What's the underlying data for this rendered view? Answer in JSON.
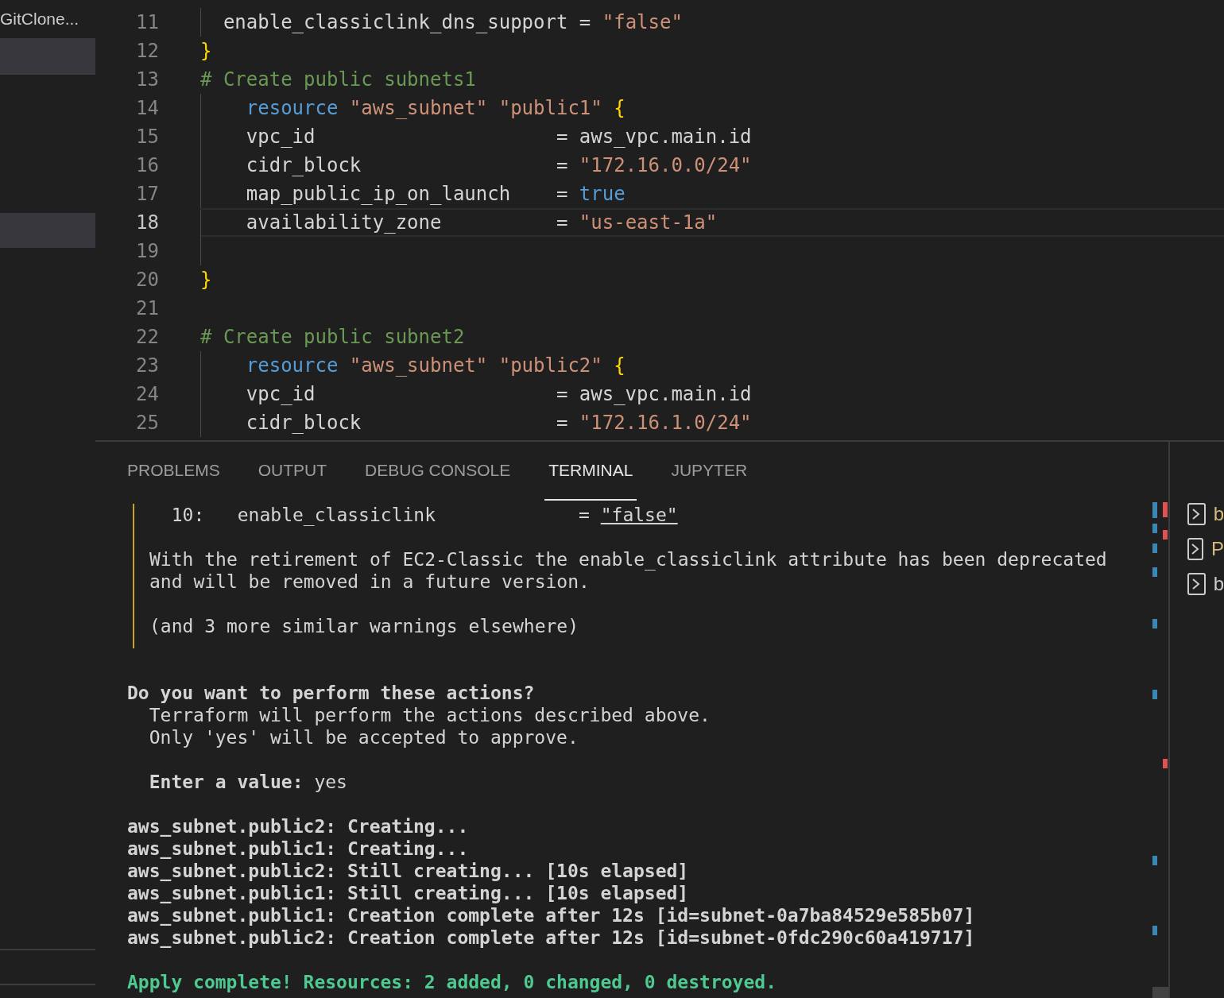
{
  "sidebar": {
    "title": "GitClone...",
    "rows": [
      {
        "selected": true
      },
      {
        "selected": true
      }
    ]
  },
  "editor": {
    "lines": [
      {
        "number": "11",
        "current": false,
        "guide": true,
        "tokens": [
          {
            "kind": "plain",
            "text": "  enable_classiclink_dns_support = "
          },
          {
            "kind": "string",
            "text": "\"false\""
          }
        ]
      },
      {
        "number": "12",
        "current": false,
        "guide": false,
        "tokens": [
          {
            "kind": "brace",
            "text": "}"
          }
        ]
      },
      {
        "number": "13",
        "current": false,
        "guide": false,
        "tokens": [
          {
            "kind": "comment",
            "text": "# Create public subnets1"
          }
        ]
      },
      {
        "number": "14",
        "current": false,
        "guide": true,
        "tokens": [
          {
            "kind": "keyword",
            "text": "    resource"
          },
          {
            "kind": "string",
            "text": " \"aws_subnet\" \"public1\" "
          },
          {
            "kind": "brace",
            "text": "{"
          }
        ]
      },
      {
        "number": "15",
        "current": false,
        "guide": true,
        "tokens": [
          {
            "kind": "plain",
            "text": "    vpc_id                     = aws_vpc.main.id"
          }
        ]
      },
      {
        "number": "16",
        "current": false,
        "guide": true,
        "tokens": [
          {
            "kind": "plain",
            "text": "    cidr_block                 = "
          },
          {
            "kind": "string",
            "text": "\"172.16.0.0/24\""
          }
        ]
      },
      {
        "number": "17",
        "current": false,
        "guide": true,
        "tokens": [
          {
            "kind": "plain",
            "text": "    map_public_ip_on_launch    = "
          },
          {
            "kind": "keyword",
            "text": "true"
          }
        ]
      },
      {
        "number": "18",
        "current": true,
        "guide": true,
        "tokens": [
          {
            "kind": "plain",
            "text": "    availability_zone          = "
          },
          {
            "kind": "string",
            "text": "\"us-east-1a\""
          }
        ]
      },
      {
        "number": "19",
        "current": false,
        "guide": true
      },
      {
        "number": "20",
        "current": false,
        "guide": false,
        "tokens": [
          {
            "kind": "brace",
            "text": "}"
          }
        ]
      },
      {
        "number": "21",
        "current": false,
        "guide": false
      },
      {
        "number": "22",
        "current": false,
        "guide": false,
        "tokens": [
          {
            "kind": "comment",
            "text": "# Create public subnet2"
          }
        ]
      },
      {
        "number": "23",
        "current": false,
        "guide": true,
        "tokens": [
          {
            "kind": "keyword",
            "text": "    resource"
          },
          {
            "kind": "string",
            "text": " \"aws_subnet\" \"public2\" "
          },
          {
            "kind": "brace",
            "text": "{"
          }
        ]
      },
      {
        "number": "24",
        "current": false,
        "guide": true,
        "tokens": [
          {
            "kind": "plain",
            "text": "    vpc_id                     = aws_vpc.main.id"
          }
        ]
      },
      {
        "number": "25",
        "current": false,
        "guide": true,
        "tokens": [
          {
            "kind": "plain",
            "text": "    cidr_block                 = "
          },
          {
            "kind": "string",
            "text": "\"172.16.1.0/24\""
          }
        ]
      }
    ]
  },
  "panel": {
    "tabs": [
      {
        "label": "PROBLEMS",
        "selected": false
      },
      {
        "label": "OUTPUT",
        "selected": false
      },
      {
        "label": "DEBUG CONSOLE",
        "selected": false
      },
      {
        "label": "TERMINAL",
        "selected": true
      },
      {
        "label": "JUPYTER",
        "selected": false
      }
    ],
    "terminal": {
      "warning_box": [
        [
          [
            {
              "kind": "plain",
              "text": "  10:   enable_classiclink             = "
            },
            {
              "kind": "underline",
              "text": "\"false\""
            }
          ]
        ],
        [
          [
            {
              "kind": "plain",
              "text": "With the retirement of EC2-Classic the enable_classiclink attribute has been deprecated"
            }
          ],
          [
            {
              "kind": "plain",
              "text": "and will be removed in a future version."
            }
          ]
        ],
        [
          [
            {
              "kind": "plain",
              "text": "(and 3 more similar warnings elsewhere)"
            }
          ]
        ]
      ],
      "paragraphs": [
        [
          [
            {
              "kind": "bold",
              "text": "Do you want to perform these actions?"
            }
          ],
          [
            {
              "kind": "plain",
              "text": "  Terraform will perform the actions described above."
            }
          ],
          [
            {
              "kind": "plain",
              "text": "  Only 'yes' will be accepted to approve."
            }
          ]
        ],
        [
          [
            {
              "kind": "bold",
              "text": "  Enter a value:"
            },
            {
              "kind": "plain",
              "text": " yes"
            }
          ]
        ],
        [
          [
            {
              "kind": "bold",
              "text": "aws_subnet.public2: Creating..."
            }
          ],
          [
            {
              "kind": "bold",
              "text": "aws_subnet.public1: Creating..."
            }
          ],
          [
            {
              "kind": "bold",
              "text": "aws_subnet.public2: Still creating... [10s elapsed]"
            }
          ],
          [
            {
              "kind": "bold",
              "text": "aws_subnet.public1: Still creating... [10s elapsed]"
            }
          ],
          [
            {
              "kind": "bold",
              "text": "aws_subnet.public1: Creation complete after 12s [id=subnet-0a7ba84529e585b07]"
            }
          ],
          [
            {
              "kind": "bold",
              "text": "aws_subnet.public2: Creation complete after 12s [id=subnet-0fdc290c60a419717]"
            }
          ]
        ],
        [
          [
            {
              "kind": "success",
              "text": "Apply complete! Resources: 2 added, 0 changed, 0 destroyed."
            }
          ]
        ]
      ]
    },
    "terminal_list": [
      {
        "label": "b",
        "color": "#d7ba7d"
      },
      {
        "label": "P",
        "color": "#d7ba7d"
      },
      {
        "label": "b",
        "color": "#cccccc"
      }
    ]
  }
}
